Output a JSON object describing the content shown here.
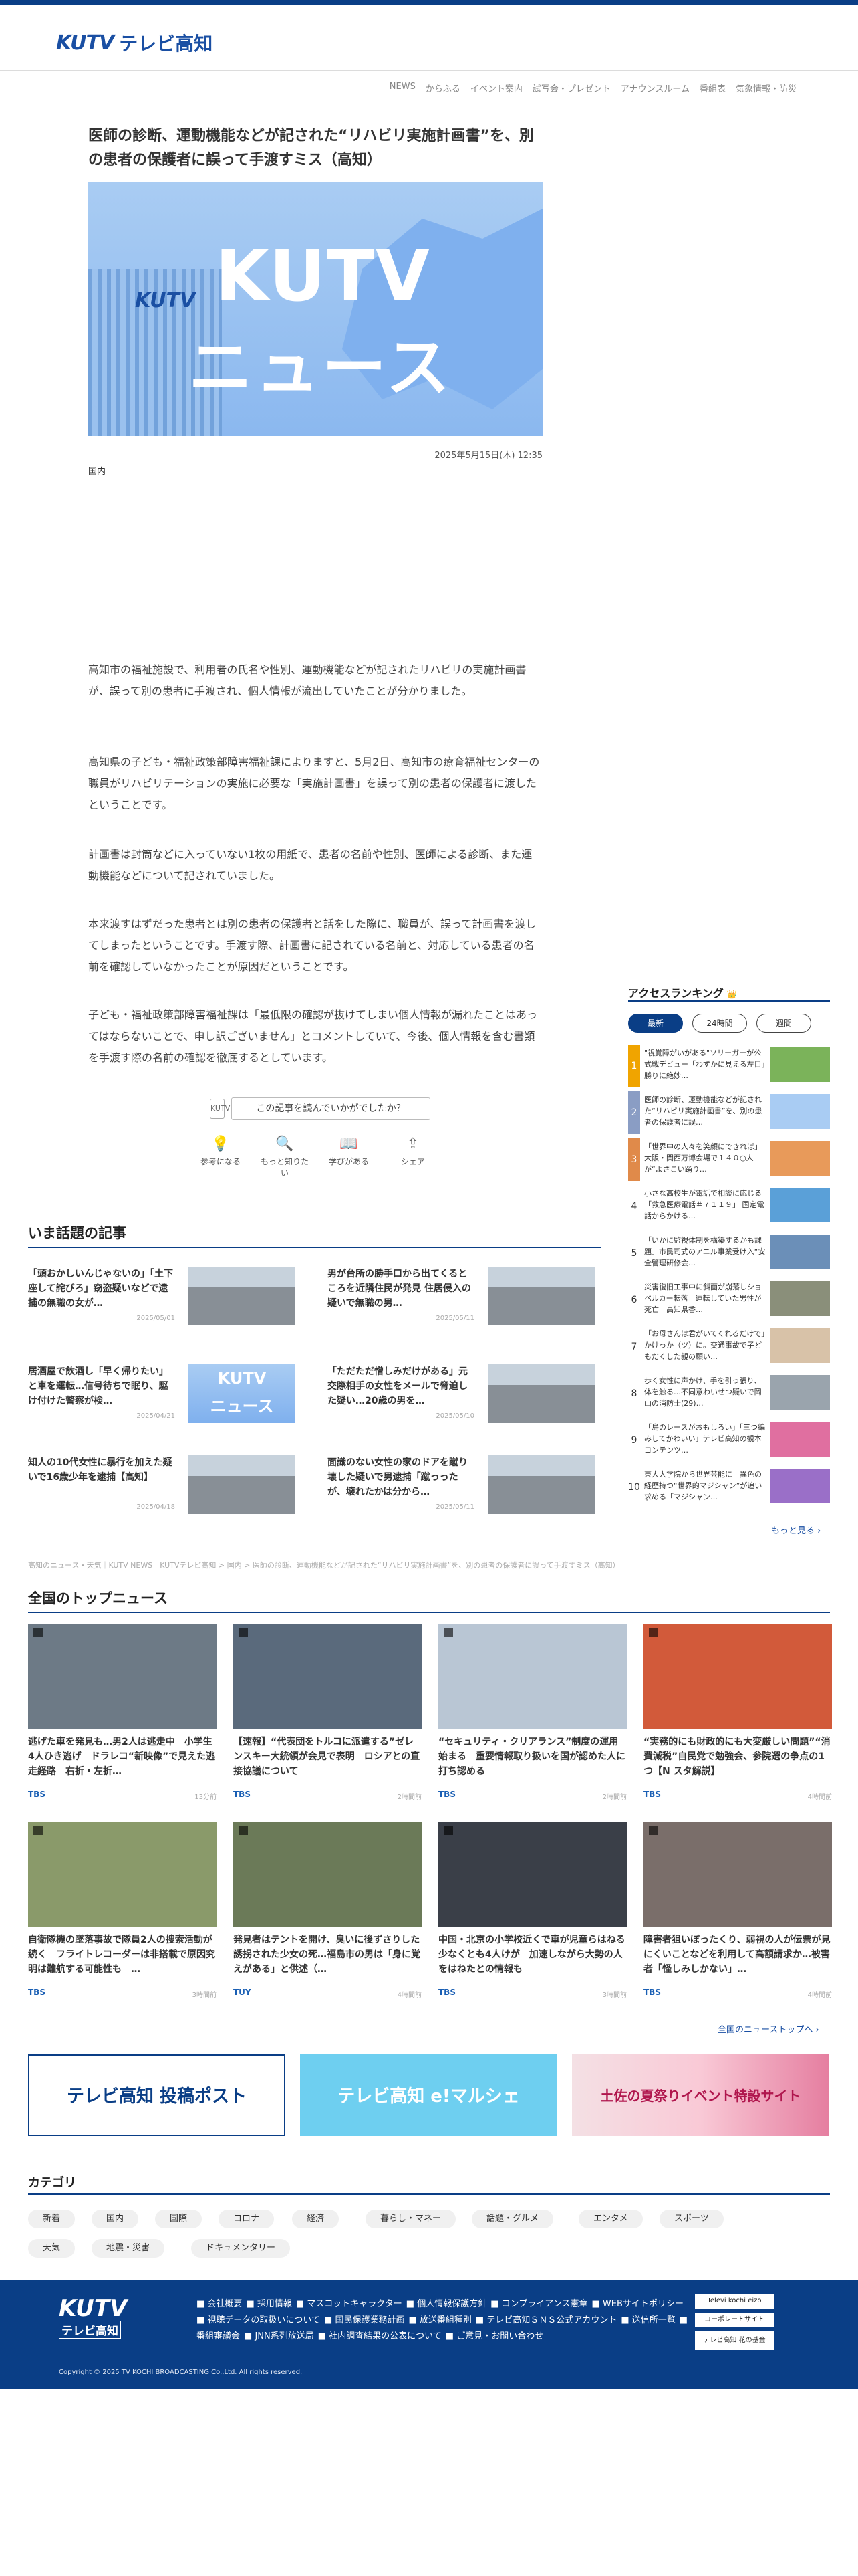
{
  "header": {
    "logo_mark": "KUTV",
    "logo_text": "テレビ高知"
  },
  "gnav": [
    "NEWS",
    "からふる",
    "イベント案内",
    "試写会・プレゼント",
    "アナウンスルーム",
    "番組表",
    "気象情報・防災"
  ],
  "article": {
    "title": "医師の診断、運動機能などが記された“リハビリ実施計画書”を、別の患者の保護者に誤って手渡すミス（高知）",
    "hero_line1": "KUTV",
    "hero_line2": "ニュース",
    "hero_badge": "KUTV",
    "date": "2025年5月15日(木) 12:35",
    "tag": "国内",
    "paragraphs": [
      "高知市の福祉施設で、利用者の氏名や性別、運動機能などが記されたリハビリの実施計画書が、誤って別の患者に手渡され、個人情報が流出していたことが分かりました。",
      "高知県の子ども・福祉政策部障害福祉課によりますと、5月2日、高知市の療育福祉センターの職員がリハビリテーションの実施に必要な「実施計画書」を誤って別の患者の保護者に渡したということです。",
      "計画書は封筒などに入っていない1枚の用紙で、患者の名前や性別、医師による診断、また運動機能などについて記されていました。",
      "本来渡すはずだった患者とは別の患者の保護者と話をした際に、職員が、誤って計画書を渡してしまったということです。手渡す際、計画書に記されている名前と、対応している患者の名前を確認していなかったことが原因だということです。",
      "子ども・福祉政策部障害福祉課は「最低限の確認が抜けてしまい個人情報が漏れたことはあってはならないことで、申し訳ございません」とコメントしていて、今後、個人情報を含む書類を手渡す際の名前の確認を徹底するとしています。"
    ],
    "feedback_question": "この記事を読んでいかがでしたか？",
    "feedback_icon": "KUTV",
    "reactions": [
      {
        "icon": "💡",
        "label": "参考になる"
      },
      {
        "icon": "🔍",
        "label": "もっと知りたい"
      },
      {
        "icon": "📖",
        "label": "学びがある"
      },
      {
        "icon": "⇪",
        "label": "シェア"
      }
    ]
  },
  "trending": {
    "title": "いま話題の記事",
    "items": [
      {
        "title": "「頭おかしいんじゃないの」「土下座して詫びろ」窃盗疑いなどで逮捕の無職の女が…",
        "date": "2025/05/01",
        "img": "bld"
      },
      {
        "title": "男が台所の勝手口から出てくるところを近隣住民が発見 住居侵入の疑いで無職の男…",
        "date": "2025/05/11",
        "img": "bld"
      },
      {
        "title": "居酒屋で飲酒し「早く帰りたい」と車を運転…信号待ちで眠り、駆け付けた警察が検…",
        "date": "2025/04/21",
        "img": "kutv"
      },
      {
        "title": "「ただただ憎しみだけがある」元交際相手の女性をメールで脅迫した疑い…20歳の男を…",
        "date": "2025/05/10",
        "img": "bld"
      },
      {
        "title": "知人の10代女性に暴行を加えた疑いで16歳少年を逮捕【高知】",
        "date": "2025/04/18",
        "img": "bld"
      },
      {
        "title": "面識のない女性の家のドアを蹴り壊した疑いで男逮捕「蹴っったが、壊れたかは分から…",
        "date": "2025/05/11",
        "img": "bld"
      }
    ]
  },
  "breadcrumb": "高知のニュース・天気｜KUTV NEWS｜KUTVテレビ高知 > 国内 > 医師の診断、運動機能などが記された“リハビリ実施計画書”を、別の患者の保護者に誤って手渡すミス（高知）",
  "ranking": {
    "title": "アクセスランキング",
    "crown": "👑",
    "tabs": [
      "最新",
      "24時間",
      "週間"
    ],
    "items": [
      {
        "rank": "1",
        "title": "\"視覚障がいがある\"ソリーガーが公式戦デビュー「わずかに見える左目」勝りに絶妙…"
      },
      {
        "rank": "2",
        "title": "医師の診断、運動機能などが記された“リハビリ実施計画書”を、別の患者の保護者に誤…"
      },
      {
        "rank": "3",
        "title": "「世界中の人々を笑顔にできれば」大阪・関西万博会場で１４０○人が“よさこい踊り…"
      },
      {
        "rank": "4",
        "title": "小さな高校生が電話で相談に応じる「救急医療電話＃７１１９」 国定電話からかける…"
      },
      {
        "rank": "5",
        "title": "「いかに監視体制を構築するかも課題」市民司式のアニル事業受け入“安全管理研修会…"
      },
      {
        "rank": "6",
        "title": "災害復旧工事中に斜面が崩落しショベルカー転落　運転していた男性が死亡　高知県香…"
      },
      {
        "rank": "7",
        "title": "「お母さんは君がいてくれるだけで」かけっか（ツ）に。交通事故で子どもだくした親の願い…"
      },
      {
        "rank": "8",
        "title": "歩く女性に声かけ、手を引っ張り、体を触る…不同意わいせつ疑いで岡山の消防士(29)…"
      },
      {
        "rank": "9",
        "title": "「島のレースがおもしろい」「三つ編みしてかわいい」テレビ高知の観本コンテンツ…"
      },
      {
        "rank": "10",
        "title": "東大大学院から世界芸能に　異色の経歴持つ“世界的マジシャン”が追い求める「マジシャン…"
      }
    ],
    "more": "もっと見る ›"
  },
  "top_news": {
    "title": "全国のトップニュース",
    "items": [
      {
        "title": "逃げた車を発見も…男2人は逃走中　小学生4人ひき逃げ　ドラレコ“新映像”で見えた逃走経路　右折・左折…",
        "src": "TBS",
        "time": "13分前",
        "img": "#6d7a86"
      },
      {
        "title": "【速報】“代表団をトルコに派遣する”ゼレンスキー大統領が会見で表明　ロシアとの直接協議について",
        "src": "TBS",
        "time": "2時間前",
        "img": "#5a6a7c"
      },
      {
        "title": "“セキュリティ・クリアランス”制度の運用始まる　重要情報取り扱いを国が認めた人に打ち認める",
        "src": "TBS",
        "time": "2時間前",
        "img": "#b9c6d4"
      },
      {
        "title": "“実務的にも財政的にも大変厳しい問題”“消費減税”自民党で勉強会、参院選の争点の1つ【N スタ解説】",
        "src": "TBS",
        "time": "4時間前",
        "img": "#d25a3a"
      },
      {
        "title": "自衛隊機の墜落事故で隊員2人の捜索活動が続く　フライトレコーダーは非搭載で原因究明は難航する可能性も　…",
        "src": "TBS",
        "time": "3時間前",
        "img": "#8a9a6a"
      },
      {
        "title": "発見者はテントを開け、臭いに後ずさりした　誘拐された少女の死…福島市の男は「身に覚えがある」と供述（…",
        "src": "TUY",
        "time": "4時間前",
        "img": "#6b7a58"
      },
      {
        "title": "中国・北京の小学校近くで車が児童らはねる　少なくとも4人けが　加速しながら大勢の人をはねたとの情報も",
        "src": "TBS",
        "time": "3時間前",
        "img": "#3a3f48"
      },
      {
        "title": "障害者狙いぼったくり、弱視の人が伝票が見にくいことなどを利用して高額請求か…被害者「怪しみしかない」…",
        "src": "TBS",
        "time": "4時間前",
        "img": "#7a6e6a"
      }
    ],
    "more": "全国のニューストップへ ›"
  },
  "banners": [
    {
      "text": "テレビ高知 投稿ポスト",
      "bg": "#ffffff"
    },
    {
      "text": "テレビ高知 e!マルシェ",
      "bg": "#6ecff0"
    },
    {
      "text": "土佐の夏祭りイベント特設サイト",
      "bg": "#f4e0e4"
    }
  ],
  "categories": {
    "title": "カテゴリ",
    "items": [
      "新着",
      "国内",
      "国際",
      "コロナ",
      "経済",
      "暮らし・マネー",
      "話題・グルメ",
      "エンタメ",
      "スポーツ",
      "天気",
      "地震・災害",
      "ドキュメンタリー"
    ]
  },
  "footer": {
    "logo": "KUTV",
    "logo_sub": "テレビ高知",
    "links": [
      "会社概要",
      "採用情報",
      "マスコットキャラクター",
      "個人情報保護方針",
      "コンプライアンス憲章",
      "WEBサイトポリシー",
      "視聴データの取扱いについて",
      "国民保護業務計画",
      "放送番組種別",
      "テレビ高知ＳＮＳ公式アカウント",
      "送信所一覧",
      "番組審議会",
      "JNN系列放送局",
      "社内調査結果の公表について",
      "ご意見・お問い合わせ"
    ],
    "badges": [
      "Televi kochi eizo",
      "コーポレートサイト",
      "テレビ高知 花の基金"
    ],
    "copyright": "Copyright © 2025 TV KOCHI BROADCASTING Co.,Ltd. All rights reserved."
  },
  "colors": {
    "brand": "#0a3e86",
    "link": "#1a4fa3",
    "rank_top": "#f0a400"
  }
}
